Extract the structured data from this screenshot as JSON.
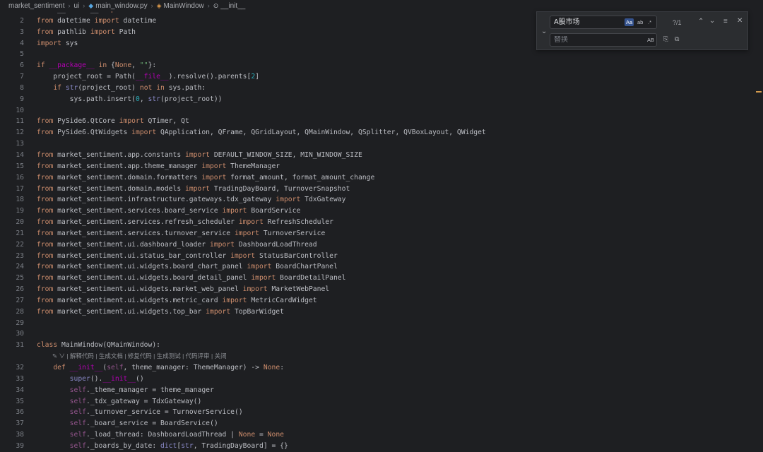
{
  "breadcrumb": {
    "items": [
      "market_sentiment",
      "ui",
      "main_window.py",
      "MainWindow",
      "__init__"
    ]
  },
  "find": {
    "search_value": "A股市场",
    "replace_placeholder": "替换",
    "match_case": "Aa",
    "whole_word": "ab",
    "regex": ".*",
    "preserve_case": "AB",
    "count": "?/1"
  },
  "codelens": "✎ ∨ | 解释代码 | 生成文档 | 修复代码 | 生成测试 | 代码评审 | 关闭",
  "colors": {
    "background": "#1e1f22",
    "keyword": "#cf8e6d",
    "string": "#6aab73",
    "number": "#2aacb8",
    "find_active": "#35538f"
  },
  "lines": [
    {
      "n": "1",
      "html": "<span class='k'>from</span> __future__ <span class='k'>import</span> annotations"
    },
    {
      "n": "2",
      "html": "<span class='k'>from</span> datetime <span class='k'>import</span> datetime"
    },
    {
      "n": "3",
      "html": "<span class='k'>from</span> pathlib <span class='k'>import</span> Path"
    },
    {
      "n": "4",
      "html": "<span class='k'>import</span> sys"
    },
    {
      "n": "5",
      "html": ""
    },
    {
      "n": "6",
      "html": "<span class='k'>if</span> <span class='dn'>__package__</span> <span class='k'>in</span> {<span class='k'>None</span>, <span class='s'>\"\"</span>}:"
    },
    {
      "n": "7",
      "html": "    project_root = Path(<span class='dn'>__file__</span>).resolve().parents[<span class='n'>2</span>]"
    },
    {
      "n": "8",
      "html": "    <span class='k'>if</span> <span class='b'>str</span>(project_root) <span class='k'>not in</span> sys.path:"
    },
    {
      "n": "9",
      "html": "        sys.path.insert(<span class='n'>0</span>, <span class='b'>str</span>(project_root))"
    },
    {
      "n": "10",
      "html": ""
    },
    {
      "n": "11",
      "html": "<span class='k'>from</span> PySide6.QtCore <span class='k'>import</span> QTimer, Qt"
    },
    {
      "n": "12",
      "html": "<span class='k'>from</span> PySide6.QtWidgets <span class='k'>import</span> QApplication, QFrame, QGridLayout, QMainWindow, QSplitter, QVBoxLayout, QWidget"
    },
    {
      "n": "13",
      "html": ""
    },
    {
      "n": "14",
      "html": "<span class='k'>from</span> market_sentiment.app.constants <span class='k'>import</span> DEFAULT_WINDOW_SIZE, MIN_WINDOW_SIZE"
    },
    {
      "n": "15",
      "html": "<span class='k'>from</span> market_sentiment.app.theme_manager <span class='k'>import</span> ThemeManager"
    },
    {
      "n": "16",
      "html": "<span class='k'>from</span> market_sentiment.domain.formatters <span class='k'>import</span> format_amount, format_amount_change"
    },
    {
      "n": "17",
      "html": "<span class='k'>from</span> market_sentiment.domain.models <span class='k'>import</span> TradingDayBoard, TurnoverSnapshot"
    },
    {
      "n": "18",
      "html": "<span class='k'>from</span> market_sentiment.infrastructure.gateways.tdx_gateway <span class='k'>import</span> TdxGateway"
    },
    {
      "n": "19",
      "html": "<span class='k'>from</span> market_sentiment.services.board_service <span class='k'>import</span> BoardService"
    },
    {
      "n": "20",
      "html": "<span class='k'>from</span> market_sentiment.services.refresh_scheduler <span class='k'>import</span> RefreshScheduler"
    },
    {
      "n": "21",
      "html": "<span class='k'>from</span> market_sentiment.services.turnover_service <span class='k'>import</span> TurnoverService"
    },
    {
      "n": "22",
      "html": "<span class='k'>from</span> market_sentiment.ui.dashboard_loader <span class='k'>import</span> DashboardLoadThread"
    },
    {
      "n": "23",
      "html": "<span class='k'>from</span> market_sentiment.ui.status_bar_controller <span class='k'>import</span> StatusBarController"
    },
    {
      "n": "24",
      "html": "<span class='k'>from</span> market_sentiment.ui.widgets.board_chart_panel <span class='k'>import</span> BoardChartPanel"
    },
    {
      "n": "25",
      "html": "<span class='k'>from</span> market_sentiment.ui.widgets.board_detail_panel <span class='k'>import</span> BoardDetailPanel"
    },
    {
      "n": "26",
      "html": "<span class='k'>from</span> market_sentiment.ui.widgets.market_web_panel <span class='k'>import</span> MarketWebPanel"
    },
    {
      "n": "27",
      "html": "<span class='k'>from</span> market_sentiment.ui.widgets.metric_card <span class='k'>import</span> MetricCardWidget"
    },
    {
      "n": "28",
      "html": "<span class='k'>from</span> market_sentiment.ui.widgets.top_bar <span class='k'>import</span> TopBarWidget"
    },
    {
      "n": "29",
      "html": ""
    },
    {
      "n": "30",
      "html": ""
    },
    {
      "n": "31",
      "html": "<span class='k'>class</span> MainWindow(QMainWindow):"
    },
    {
      "n": "",
      "html": "",
      "lens": true
    },
    {
      "n": "32",
      "html": "    <span class='k'>def</span> <span class='dn'>__init__</span>(<span class='self'>self</span>, theme_manager: ThemeManager) -> <span class='k'>None</span>:"
    },
    {
      "n": "33",
      "html": "        <span class='b'>super</span>().<span class='dn'>__init__</span>()"
    },
    {
      "n": "34",
      "html": "        <span class='self'>self</span>._theme_manager = theme_manager"
    },
    {
      "n": "35",
      "html": "        <span class='self'>self</span>._tdx_gateway = TdxGateway()"
    },
    {
      "n": "36",
      "html": "        <span class='self'>self</span>._turnover_service = TurnoverService()"
    },
    {
      "n": "37",
      "html": "        <span class='self'>self</span>._board_service = BoardService()"
    },
    {
      "n": "38",
      "html": "        <span class='self'>self</span>._load_thread: DashboardLoadThread | <span class='k'>None</span> = <span class='k'>None</span>"
    },
    {
      "n": "39",
      "html": "        <span class='self'>self</span>._boards_by_date: <span class='b'>dict</span>[<span class='b'>str</span>, TradingDayBoard] = {}"
    }
  ]
}
